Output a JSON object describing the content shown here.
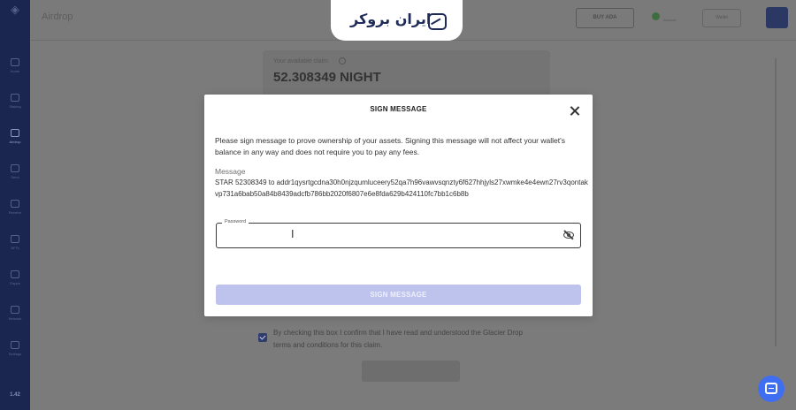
{
  "app": {
    "page_title": "Airdrop",
    "sidebar": {
      "items": [
        {
          "label": "Home",
          "icon": "wallet-icon"
        },
        {
          "label": "Staking",
          "icon": "lock-icon"
        },
        {
          "label": "Airdrop",
          "icon": "gift-icon"
        },
        {
          "label": "Send",
          "icon": "send-icon"
        },
        {
          "label": "Receive",
          "icon": "receive-icon"
        },
        {
          "label": "NFTs",
          "icon": "image-icon"
        },
        {
          "label": "Dapps",
          "icon": "grid-icon"
        },
        {
          "label": "Network",
          "icon": "network-icon"
        },
        {
          "label": "Settings",
          "icon": "gear-icon"
        }
      ],
      "version": "1.42"
    },
    "topbar": {
      "buy_label": "BUY ADA",
      "account_label": "Account",
      "wallet_label": "Wallet"
    },
    "balance": {
      "label": "Your available claim",
      "value": "52.308349 NIGHT"
    },
    "terms_text": "By checking this box I confirm that I have read and understood the Glacier Drop terms and conditions for this claim."
  },
  "brand": {
    "name": "ایران بروکر",
    "color": "#1e2b59"
  },
  "modal": {
    "title": "SIGN MESSAGE",
    "description": "Please sign message to prove ownership of your assets. Signing this message will not affect your wallet's balance in any way and does not require you to pay any fees.",
    "message_label": "Message",
    "message": "STAR 52308349 to addr1qysrtgcdna30h0njzqumluceery52qa7h96vawvsqnzty6f627hhjyls27xwmke4e4ewn27rv3qontakvp731a6bab50a84b8439adcfb786bb2020f6807e6e8fda629b424110fc7bb1c6b8b",
    "password_label": "Password",
    "password_value": "",
    "submit_label": "SIGN MESSAGE"
  },
  "colors": {
    "accent": "#3f6ff0",
    "submit_disabled": "#bdc3ec",
    "sidebar_bg": "#1a2650"
  }
}
